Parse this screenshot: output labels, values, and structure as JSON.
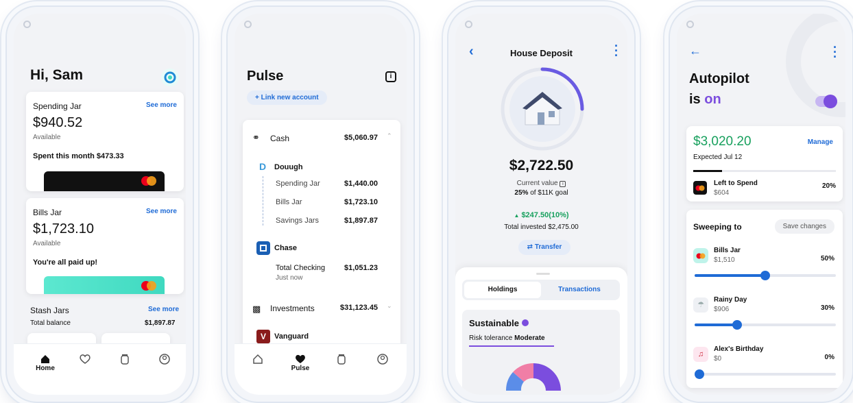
{
  "phone1": {
    "greeting": "Hi, Sam",
    "spending_jar": {
      "title": "Spending Jar",
      "see_more": "See more",
      "amount": "$940.52",
      "available": "Available",
      "spent": "Spent this month $473.33"
    },
    "bills_jar": {
      "title": "Bills Jar",
      "see_more": "See more",
      "amount": "$1,723.10",
      "available": "Available",
      "status": "You're all paid up!"
    },
    "stash": {
      "title": "Stash Jars",
      "see_more": "See more",
      "total_label": "Total balance",
      "total": "$1,897.87"
    },
    "nav": {
      "home": "Home"
    }
  },
  "phone2": {
    "title": "Pulse",
    "link_account": "+ Link new account",
    "cash": {
      "label": "Cash",
      "total": "$5,060.97"
    },
    "douugh": {
      "name": "Douugh",
      "rows": [
        {
          "label": "Spending Jar",
          "value": "$1,440.00"
        },
        {
          "label": "Bills Jar",
          "value": "$1,723.10"
        },
        {
          "label": "Savings Jars",
          "value": "$1,897.87"
        }
      ]
    },
    "chase": {
      "name": "Chase",
      "row_label": "Total Checking",
      "row_sub": "Just now",
      "row_value": "$1,051.23"
    },
    "investments": {
      "label": "Investments",
      "total": "$31,123.45"
    },
    "vanguard": {
      "name": "Vanguard"
    },
    "nav": {
      "pulse": "Pulse"
    }
  },
  "phone3": {
    "title": "House Deposit",
    "amount": "$2,722.50",
    "current_value": "Current value",
    "goal_pct": "25%",
    "goal_rest": "of $11K goal",
    "gain": "$247.50(10%)",
    "total_invested": "Total invested $2,475.00",
    "transfer": "Transfer",
    "tab_holdings": "Holdings",
    "tab_transactions": "Transactions",
    "sustainable": "Sustainable",
    "risk_label": "Risk tolerance",
    "risk_value": "Moderate",
    "progress_fraction": 0.25
  },
  "phone4": {
    "title": "Autopilot",
    "is": "is",
    "on": "on",
    "amount": "$3,020.20",
    "manage": "Manage",
    "expected": "Expected Jul 12",
    "left_to_spend": {
      "label": "Left to Spend",
      "amount": "$604",
      "pct": "20%"
    },
    "sweeping_to": "Sweeping to",
    "save_changes": "Save changes",
    "items": [
      {
        "name": "Bills Jar",
        "amount": "$1,510",
        "pct": "50%",
        "fraction": 0.5
      },
      {
        "name": "Rainy Day",
        "amount": "$906",
        "pct": "30%",
        "fraction": 0.3
      },
      {
        "name": "Alex's Birthday",
        "amount": "$0",
        "pct": "0%",
        "fraction": 0.0
      }
    ]
  },
  "colors": {
    "accent_blue": "#1f6bd6",
    "purple": "#7b4dde",
    "teal": "#3fd9c0",
    "green": "#17a05d"
  }
}
